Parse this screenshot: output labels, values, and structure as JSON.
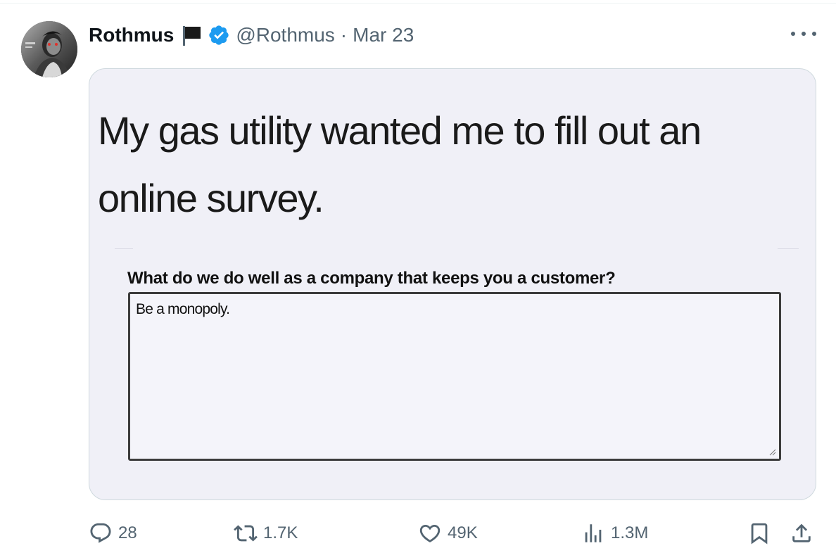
{
  "tweet": {
    "author": {
      "display_name": "Rothmus",
      "handle": "@Rothmus",
      "avatar_icon": "profile-avatar",
      "flag_icon": "black-flag-icon",
      "verified_icon": "verified-badge-icon",
      "verified_color": "#1d9bf0"
    },
    "separator": "·",
    "date": "Mar 23",
    "more_icon": "more-horizontal-icon",
    "media": {
      "caption": "My gas utility wanted me to fill out an online survey.",
      "survey": {
        "question": "What do we do well as a company that keeps you a customer?",
        "answer": "Be a monopoly."
      }
    },
    "actions": {
      "reply": {
        "icon": "reply-bubble-icon",
        "count": "28"
      },
      "retweet": {
        "icon": "retweet-icon",
        "count": "1.7K"
      },
      "like": {
        "icon": "heart-icon",
        "count": "49K"
      },
      "views": {
        "icon": "views-bar-chart-icon",
        "count": "1.3M"
      },
      "bookmark": {
        "icon": "bookmark-icon"
      },
      "share": {
        "icon": "share-upload-icon"
      }
    }
  },
  "colors": {
    "text_primary": "#0f1419",
    "text_secondary": "#536471",
    "border": "#cfd9de",
    "media_background": "#f0f0f7"
  }
}
